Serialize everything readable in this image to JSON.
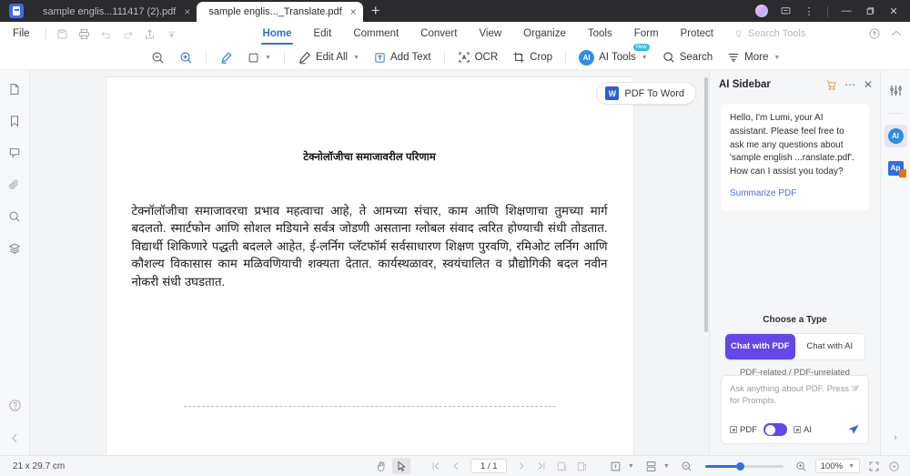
{
  "window": {
    "tabs": [
      {
        "label": "sample  englis...111417 (2).pdf",
        "active": false,
        "close": "×"
      },
      {
        "label": "sample  englis..._Translate.pdf",
        "active": true,
        "close": "×"
      }
    ],
    "new_tab": "+",
    "controls": {
      "minimize": "—",
      "maximize": "❐",
      "close": "✕",
      "menu": "⋮"
    }
  },
  "menubar": {
    "file": "File",
    "quick_icons": [
      "save-icon",
      "print-icon",
      "undo-icon",
      "redo-icon",
      "share-icon",
      "more-down-icon"
    ],
    "tabs": [
      {
        "label": "Home",
        "active": true
      },
      {
        "label": "Edit",
        "active": false
      },
      {
        "label": "Comment",
        "active": false
      },
      {
        "label": "Convert",
        "active": false
      },
      {
        "label": "View",
        "active": false
      },
      {
        "label": "Organize",
        "active": false
      },
      {
        "label": "Tools",
        "active": false
      },
      {
        "label": "Form",
        "active": false
      },
      {
        "label": "Protect",
        "active": false
      }
    ],
    "search_tools": "Search Tools",
    "right_icons": [
      "cloud-upload-icon",
      "collapse-ribbon-icon"
    ]
  },
  "toolbar": {
    "zoom_out": "zoom-out-icon",
    "zoom_in": "zoom-in-icon",
    "highlight": "highlighter-icon",
    "shape": "shape-icon",
    "edit_all": "Edit All",
    "add_text": "Add Text",
    "ocr": "OCR",
    "crop": "Crop",
    "ai_tools": "AI Tools",
    "ai_badge": "New",
    "search": "Search",
    "more": "More"
  },
  "left_rail": {
    "items": [
      {
        "name": "thumbnails-icon"
      },
      {
        "name": "bookmark-icon"
      },
      {
        "name": "comment-icon"
      },
      {
        "name": "attachment-icon"
      },
      {
        "name": "search-icon"
      },
      {
        "name": "layers-icon"
      }
    ],
    "bottom": [
      {
        "name": "help-icon"
      },
      {
        "name": "collapse-left-icon"
      }
    ]
  },
  "document": {
    "convert_button": "PDF To Word",
    "convert_badge": "W",
    "title": "टेक्नोलॉजीचा समाजावरील परिणाम",
    "body": "टेक्नॉलॉजीचा समाजावरचा प्रभाव महत्वाचा आहे, ते आमच्या संचार, काम आणि शिक्षणाचा तुमच्या मार्ग बदलतो. स्मार्टफोन आणि सोशल मडियाने सर्वत्र जोडणी असताना ग्लोबल संवाद त्वरित होण्याची संधी तोडतात. विद्यार्थी शिकिणारे पद्धती बदलले आहेत, ई-लर्निग प्लॅटफॉर्म सर्वसाधारण शिक्षण पुरवणि, रमिओट लर्निग आणि कौशल्य विकासास काम मळिवणियाची शक्यता देतात. कार्यस्थळावर, स्वयंचालित व प्रौद्योगिकी बदल नवीन नोकरी संधी उघडतात."
  },
  "ai_sidebar": {
    "title": "AI Sidebar",
    "header_icons": [
      "cart-icon",
      "more-icon",
      "close-icon"
    ],
    "greeting": "Hello, I'm Lumi, your AI assistant. Please feel free to ask me any questions about 'sample english ...ranslate.pdf'. How can I assist you today?",
    "summarize_link": "Summarize PDF",
    "choose_label": "Choose a Type",
    "types": [
      {
        "label": "Chat with PDF",
        "selected": true
      },
      {
        "label": "Chat with AI",
        "selected": false
      }
    ],
    "type_hint": "PDF-related / PDF-unrelated",
    "composer_placeholder": "Ask anything about PDF. Press '#' for Prompts.",
    "chip_pdf": "PDF",
    "chip_ai": "AI",
    "send_icon": "send-icon"
  },
  "right_rail": {
    "items": [
      {
        "name": "sliders-icon",
        "selected": false
      },
      {
        "name": "ai-assistant-icon",
        "label": "AI",
        "selected": true
      },
      {
        "name": "ai-pro-icon",
        "label": "Ap",
        "selected": false
      }
    ],
    "expand": "›"
  },
  "statusbar": {
    "dimensions": "21 x 29.7 cm",
    "tools": [
      "hand-tool-icon",
      "select-tool-icon"
    ],
    "nav": {
      "first": "|⟨",
      "prev": "‹",
      "next": "›",
      "last": "⟩|"
    },
    "page_value": "1 / 1",
    "view_icons": [
      "single-page-icon",
      "continuous-scroll-icon",
      "page-fit-icon",
      "page-layout-icon"
    ],
    "zoom_out": "zoom-out-icon",
    "zoom_in": "zoom-in-icon",
    "zoom_level": "100%",
    "fullscreen": "fullscreen-icon",
    "rotate": "rotate-icon"
  },
  "colors": {
    "accent": "#2f6fe4",
    "purple": "#6546e8",
    "titlebar": "#2b2b2e",
    "panel": "#f5f6f8"
  }
}
